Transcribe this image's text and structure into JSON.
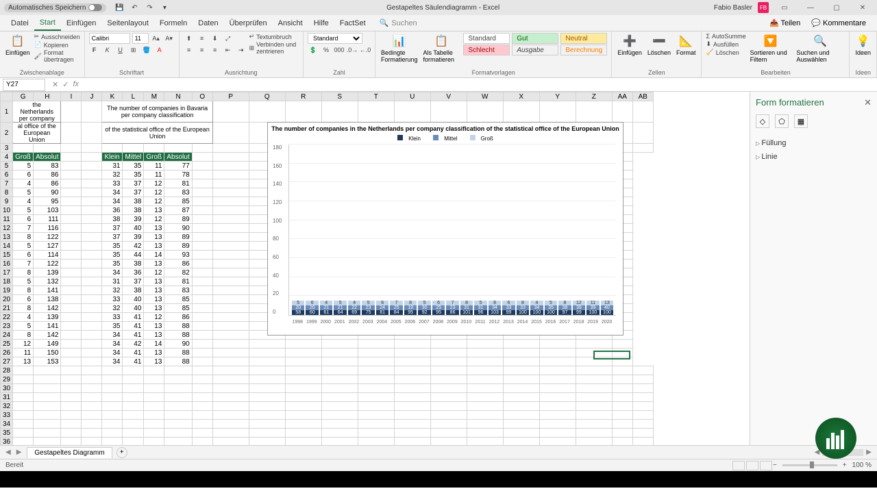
{
  "titlebar": {
    "autosave": "Automatisches Speichern",
    "title": "Gestapeltes Säulendiagramm - Excel",
    "user": "Fabio Basler",
    "user_initials": "FB"
  },
  "tabs": {
    "datei": "Datei",
    "start": "Start",
    "einfuegen": "Einfügen",
    "seitenlayout": "Seitenlayout",
    "formeln": "Formeln",
    "daten": "Daten",
    "ueberpruefen": "Überprüfen",
    "ansicht": "Ansicht",
    "hilfe": "Hilfe",
    "factset": "FactSet",
    "suchen": "Suchen",
    "teilen": "Teilen",
    "kommentare": "Kommentare"
  },
  "ribbon": {
    "einfuegen": "Einfügen",
    "ausschneiden": "Ausschneiden",
    "kopieren": "Kopieren",
    "format_uebertragen": "Format übertragen",
    "zwischenablage": "Zwischenablage",
    "font_name": "Calibri",
    "font_size": "11",
    "schriftart": "Schriftart",
    "textumbruch": "Textumbruch",
    "verbinden": "Verbinden und zentrieren",
    "ausrichtung": "Ausrichtung",
    "zahlformat": "Standard",
    "zahl": "Zahl",
    "bedingte": "Bedingte Formatierung",
    "als_tabelle": "Als Tabelle formatieren",
    "formatvorlagen": "Formatvorlagen",
    "style_standard": "Standard",
    "style_gut": "Gut",
    "style_neutral": "Neutral",
    "style_schlecht": "Schlecht",
    "style_ausgabe": "Ausgabe",
    "style_berechnung": "Berechnung",
    "zellen_einfuegen": "Einfügen",
    "loeschen": "Löschen",
    "format": "Format",
    "zellen": "Zellen",
    "autosumme": "AutoSumme",
    "ausfuellen": "Ausfüllen",
    "loeschen2": "Löschen",
    "sortieren": "Sortieren und Filtern",
    "suchen2": "Suchen und Auswählen",
    "bearbeiten": "Bearbeiten",
    "ideen": "Ideen"
  },
  "formula": {
    "name_box": "Y27"
  },
  "columns": [
    "G",
    "H",
    "I",
    "J",
    "K",
    "L",
    "M",
    "N",
    "O",
    "P",
    "Q",
    "R",
    "S",
    "T",
    "U",
    "V",
    "W",
    "X",
    "Y",
    "Z",
    "AA",
    "AB"
  ],
  "table1": {
    "title1": "the Netherlands per company",
    "title2": "al office of the European Union",
    "headers": [
      "Groß",
      "Absolut"
    ],
    "rows": [
      [
        5,
        83
      ],
      [
        6,
        86
      ],
      [
        4,
        86
      ],
      [
        5,
        90
      ],
      [
        4,
        95
      ],
      [
        5,
        103
      ],
      [
        6,
        111
      ],
      [
        7,
        116
      ],
      [
        8,
        122
      ],
      [
        5,
        127
      ],
      [
        6,
        114
      ],
      [
        7,
        122
      ],
      [
        8,
        139
      ],
      [
        5,
        132
      ],
      [
        8,
        141
      ],
      [
        6,
        138
      ],
      [
        8,
        142
      ],
      [
        4,
        139
      ],
      [
        5,
        141
      ],
      [
        8,
        142
      ],
      [
        12,
        149
      ],
      [
        11,
        150
      ],
      [
        13,
        153
      ]
    ]
  },
  "table2": {
    "title1": "The number of companies in Bavaria per company classification",
    "title2": "of the statistical office of the European Union",
    "headers": [
      "Klein",
      "Mittel",
      "Groß",
      "Absolut"
    ],
    "rows": [
      [
        31,
        35,
        11,
        77
      ],
      [
        32,
        35,
        11,
        78
      ],
      [
        33,
        37,
        12,
        81
      ],
      [
        34,
        37,
        12,
        83
      ],
      [
        34,
        38,
        12,
        85
      ],
      [
        36,
        38,
        13,
        87
      ],
      [
        38,
        39,
        12,
        89
      ],
      [
        37,
        40,
        13,
        90
      ],
      [
        37,
        39,
        13,
        89
      ],
      [
        35,
        42,
        13,
        89
      ],
      [
        35,
        44,
        14,
        93
      ],
      [
        35,
        38,
        13,
        86
      ],
      [
        34,
        36,
        12,
        82
      ],
      [
        31,
        37,
        13,
        81
      ],
      [
        32,
        38,
        13,
        83
      ],
      [
        33,
        40,
        13,
        85
      ],
      [
        32,
        40,
        13,
        85
      ],
      [
        33,
        41,
        12,
        86
      ],
      [
        35,
        41,
        13,
        88
      ],
      [
        34,
        41,
        13,
        88
      ],
      [
        34,
        42,
        14,
        90
      ],
      [
        34,
        41,
        13,
        88
      ],
      [
        34,
        41,
        13,
        88
      ]
    ]
  },
  "chart_data": {
    "type": "bar",
    "title": "The number of companies in the Netherlands per company classification of the statistical office of the European Union",
    "categories": [
      "1998",
      "1999",
      "2000",
      "2001",
      "2002",
      "2003",
      "2004",
      "2005",
      "2006",
      "2007",
      "2008",
      "2009",
      "2010",
      "2011",
      "2012",
      "2013",
      "2014",
      "2015",
      "2016",
      "2017",
      "2018",
      "2019",
      "2020"
    ],
    "series": [
      {
        "name": "Klein",
        "values": [
          58,
          60,
          61,
          64,
          69,
          75,
          81,
          84,
          95,
          92,
          95,
          86,
          101,
          96,
          103,
          99,
          100,
          100,
          100,
          97,
          99,
          100,
          100
        ],
        "color": "#1f3a5f"
      },
      {
        "name": "Mittel",
        "values": [
          20,
          20,
          21,
          21,
          22,
          23,
          24,
          25,
          19,
          30,
          25,
          23,
          31,
          31,
          34,
          33,
          33,
          34,
          35,
          38,
          39,
          39,
          40
        ],
        "color": "#6b8cb8"
      },
      {
        "name": "Groß",
        "values": [
          5,
          6,
          4,
          5,
          4,
          5,
          6,
          7,
          8,
          5,
          6,
          7,
          8,
          5,
          8,
          6,
          8,
          4,
          5,
          8,
          12,
          11,
          13
        ],
        "color": "#c4d4e8"
      }
    ],
    "ylim": [
      0,
      180
    ],
    "yticks": [
      0,
      20,
      40,
      60,
      80,
      100,
      120,
      140,
      160,
      180
    ]
  },
  "side": {
    "title": "Form formatieren",
    "fuellung": "Füllung",
    "linie": "Linie"
  },
  "sheet_tab": "Gestapeltes Diagramm",
  "status": {
    "bereit": "Bereit",
    "zoom": "100 %"
  }
}
